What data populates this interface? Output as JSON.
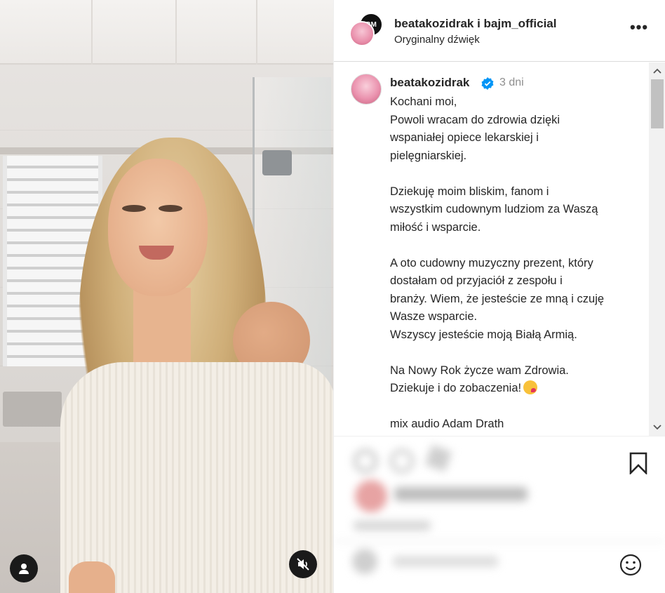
{
  "header": {
    "title": "beatakozidrak i bajm_official",
    "subtitle": "Oryginalny dźwięk",
    "back_avatar_text": "BM",
    "more_icon": "more-horizontal-icon",
    "more_label": "•••"
  },
  "caption": {
    "username": "beatakozidrak",
    "verified": true,
    "time": "3 dni",
    "lines": [
      "Kochani moi,",
      "Powoli wracam do zdrowia dzięki",
      "wspaniałej opiece lekarskiej i",
      "pielęgniarskiej.",
      "",
      "Dziekuję moim bliskim, fanom i",
      "wszystkim cudownym ludziom za Waszą",
      "miłość i wsparcie.",
      "",
      "A oto cudowny muzyczny prezent, który",
      "dostałam od przyjaciół z zespołu i",
      "branży. Wiem, że jesteście ze mną i czuję",
      "Wasze wsparcie.",
      "Wszyscy jesteście moją Białą Armią.",
      "",
      "Na Nowy Rok życze wam Zdrowia.",
      "Dziekuje i do zobaczenia!",
      "",
      "mix audio Adam Drath"
    ],
    "emoji_icon": "kissing-heart-emoji-icon"
  },
  "scrollbar": {
    "up_arrow": "^",
    "down_arrow": "v"
  },
  "icons": {
    "bookmark": "bookmark-icon",
    "emoji_picker": "smiley-icon",
    "user_tag": "user-icon",
    "mute": "speaker-muted-icon"
  },
  "colors": {
    "text": "#262626",
    "muted": "#8e8e8e",
    "verified": "#0095f6",
    "border": "#dbdbdb"
  }
}
